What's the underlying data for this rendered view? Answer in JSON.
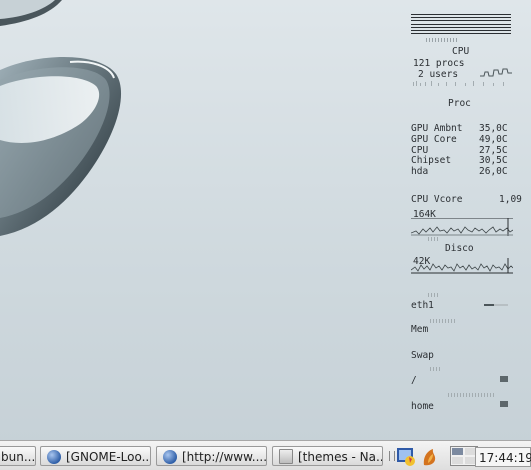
{
  "monitor": {
    "cpu_label": "CPU",
    "procs": "121 procs",
    "users": "2 users",
    "proc_label": "Proc",
    "sensors": [
      {
        "name": "GPU Ambnt",
        "value": "35,0C"
      },
      {
        "name": "GPU Core",
        "value": "49,0C"
      },
      {
        "name": "CPU",
        "value": "27,5C"
      },
      {
        "name": "Chipset",
        "value": "30,5C"
      },
      {
        "name": "hda",
        "value": "26,0C"
      }
    ],
    "vcore_label": "CPU Vcore",
    "vcore_value": "1,09",
    "rate1": "164K",
    "disk_label": "Disco",
    "rate2": "42K",
    "eth_label": "eth1",
    "mem_label": "Mem",
    "swap_label": "Swap",
    "root_label": "/",
    "home_label": "home"
  },
  "taskbar": {
    "tasks": [
      {
        "label": "bun..."
      },
      {
        "label": "[GNOME-Loo..."
      },
      {
        "label": "[http://www...."
      },
      {
        "label": "[themes - Na..."
      }
    ],
    "clock": "17:44:19"
  }
}
